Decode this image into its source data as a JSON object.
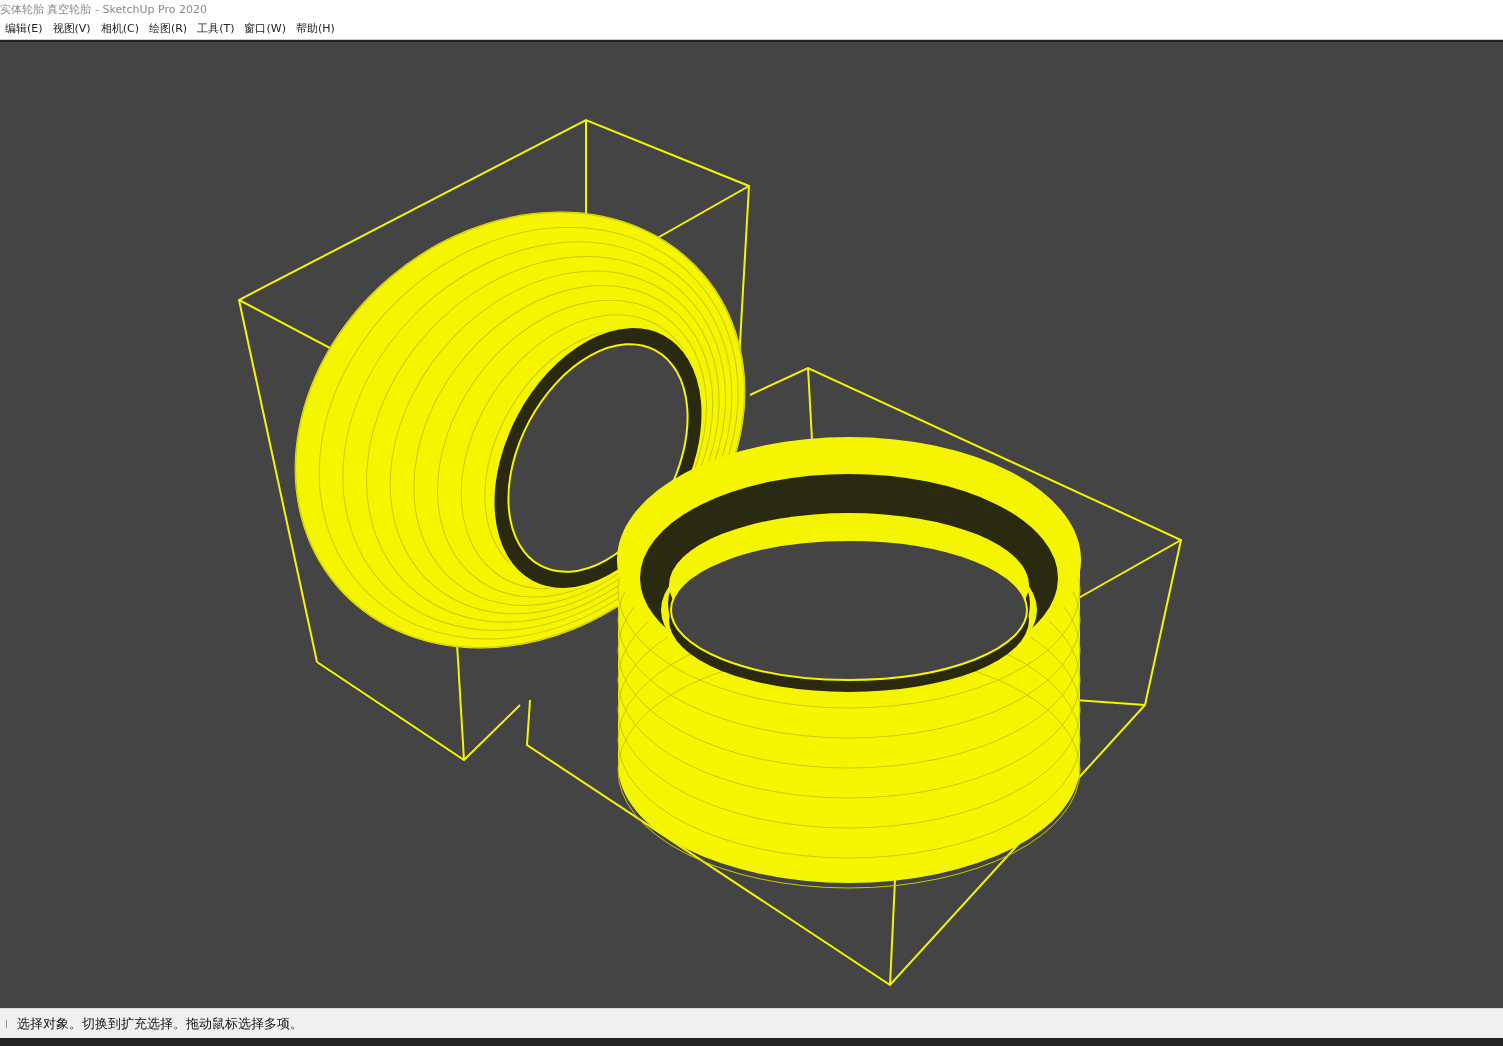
{
  "window": {
    "title": "实体轮胎 真空轮胎 - SketchUp Pro 2020"
  },
  "menu": [
    {
      "label": "编辑(E)"
    },
    {
      "label": "视图(V)"
    },
    {
      "label": "相机(C)"
    },
    {
      "label": "绘图(R)"
    },
    {
      "label": "工具(T)"
    },
    {
      "label": "窗口(W)"
    },
    {
      "label": "帮助(H)"
    }
  ],
  "status_bar": {
    "text": "选择对象。切换到扩充选择。拖动鼠标选择多项。"
  }
}
